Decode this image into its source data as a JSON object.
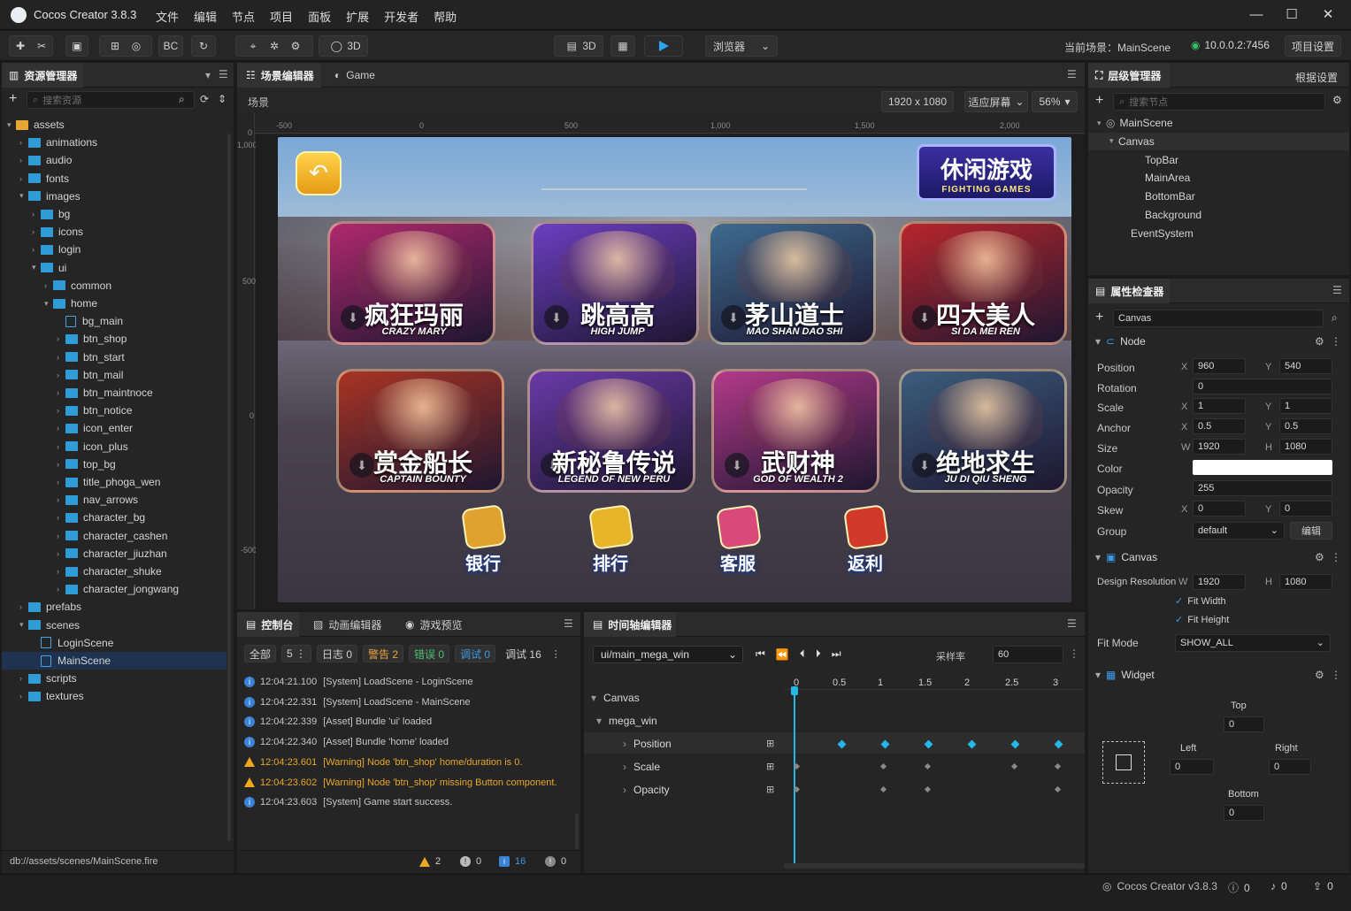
{
  "app": {
    "title": "Cocos Creator 3.8.3"
  },
  "menu": [
    "文件",
    "编辑",
    "节点",
    "项目",
    "面板",
    "扩展",
    "开发者",
    "帮助"
  ],
  "toolbar": {
    "left_btns": [
      "BC"
    ],
    "mode_3d": "3D",
    "mode_3d_b": "3D",
    "browser": "浏览器",
    "current_scene_label": "当前场景：MainScene",
    "ip": "10.0.0.2:7456",
    "project_settings": "项目设置"
  },
  "assets_panel": {
    "title": "资源管理器",
    "search_placeholder": "搜索资源",
    "tree": [
      {
        "label": "assets",
        "depth": 0,
        "open": true,
        "type": "folder"
      },
      {
        "label": "animations",
        "depth": 1,
        "type": "folder"
      },
      {
        "label": "audio",
        "depth": 1,
        "type": "folder"
      },
      {
        "label": "fonts",
        "depth": 1,
        "type": "folder"
      },
      {
        "label": "images",
        "depth": 1,
        "open": true,
        "type": "folder"
      },
      {
        "label": "bg",
        "depth": 2,
        "type": "folder"
      },
      {
        "label": "icons",
        "depth": 2,
        "type": "folder"
      },
      {
        "label": "login",
        "depth": 2,
        "type": "folder"
      },
      {
        "label": "ui",
        "depth": 2,
        "open": true,
        "type": "folder"
      },
      {
        "label": "common",
        "depth": 3,
        "type": "folder"
      },
      {
        "label": "home",
        "depth": 3,
        "open": true,
        "type": "folder"
      },
      {
        "label": "bg_main",
        "depth": 4,
        "type": "file"
      },
      {
        "label": "btn_shop",
        "depth": 4,
        "type": "folder"
      },
      {
        "label": "btn_start",
        "depth": 4,
        "type": "folder"
      },
      {
        "label": "btn_mail",
        "depth": 4,
        "type": "folder"
      },
      {
        "label": "btn_maintnoce",
        "depth": 4,
        "type": "folder"
      },
      {
        "label": "btn_notice",
        "depth": 4,
        "type": "folder"
      },
      {
        "label": "icon_enter",
        "depth": 4,
        "type": "folder"
      },
      {
        "label": "icon_plus",
        "depth": 4,
        "type": "folder"
      },
      {
        "label": "top_bg",
        "depth": 4,
        "type": "folder"
      },
      {
        "label": "title_phoga_wen",
        "depth": 4,
        "type": "folder"
      },
      {
        "label": "nav_arrows",
        "depth": 4,
        "type": "folder"
      },
      {
        "label": "character_bg",
        "depth": 4,
        "type": "folder"
      },
      {
        "label": "character_cashen",
        "depth": 4,
        "type": "folder"
      },
      {
        "label": "character_jiuzhan",
        "depth": 4,
        "type": "folder"
      },
      {
        "label": "character_shuke",
        "depth": 4,
        "type": "folder"
      },
      {
        "label": "character_jongwang",
        "depth": 4,
        "type": "folder"
      },
      {
        "label": "prefabs",
        "depth": 1,
        "type": "folder"
      },
      {
        "label": "scenes",
        "depth": 1,
        "open": true,
        "type": "folder"
      },
      {
        "label": "LoginScene",
        "depth": 2,
        "type": "file"
      },
      {
        "label": "MainScene",
        "depth": 2,
        "type": "file",
        "selected": true
      },
      {
        "label": "scripts",
        "depth": 1,
        "type": "folder"
      },
      {
        "label": "textures",
        "depth": 1,
        "type": "folder"
      }
    ],
    "path": "db://assets/scenes/MainScene.fire"
  },
  "scene_editor": {
    "tabs": [
      "场景编辑器",
      "Game"
    ],
    "breadcrumb": "场景",
    "resolution": "1920 x 1080",
    "fit": "适应屏幕",
    "zoom": "56%",
    "ruler_x": [
      "-500",
      "0",
      "500",
      "1,000",
      "1,500",
      "2,000"
    ],
    "ruler_y": [
      "1,000",
      "500",
      "0",
      "-500"
    ],
    "ruler_y_top": "0"
  },
  "game": {
    "badge_cn": "休闲游戏",
    "badge_en": "FIGHTING GAMES",
    "cards": [
      {
        "cn": "疯狂玛丽",
        "en": "CRAZY MARY",
        "color": "#b0296f"
      },
      {
        "cn": "跳高高",
        "en": "HIGH JUMP",
        "color": "#6b3fc0"
      },
      {
        "cn": "茅山道士",
        "en": "MAO SHAN DAO SHI",
        "color": "#3e6b8f"
      },
      {
        "cn": "四大美人",
        "en": "SI DA MEI REN",
        "color": "#b8262d"
      },
      {
        "cn": "赏金船长",
        "en": "CAPTAIN BOUNTY",
        "color": "#a93424"
      },
      {
        "cn": "新秘鲁传说",
        "en": "LEGEND OF NEW PERU",
        "color": "#6a3aa8"
      },
      {
        "cn": "武财神",
        "en": "GOD OF WEALTH 2",
        "color": "#b43a8a"
      },
      {
        "cn": "绝地求生",
        "en": "JU DI QIU SHENG",
        "color": "#3c5d7d"
      }
    ],
    "bottom_buttons": [
      "银行",
      "排行",
      "客服",
      "返利"
    ]
  },
  "console": {
    "tabs": [
      "控制台",
      "动画编辑器",
      "游戏预览"
    ],
    "filters": {
      "all": "全部",
      "count": "5",
      "log": "日志 0",
      "warn": "警告 2",
      "err": "错误 0",
      "debug_tab": "调试 0",
      "debug": "调试 16"
    },
    "logs": [
      {
        "type": "info",
        "time": "12:04:21.100",
        "msg": "[System] LoadScene - LoginScene"
      },
      {
        "type": "info",
        "time": "12:04:22.331",
        "msg": "[System] LoadScene - MainScene"
      },
      {
        "type": "info",
        "time": "12:04:22.339",
        "msg": "[Asset] Bundle 'ui' loaded"
      },
      {
        "type": "info",
        "time": "12:04:22.340",
        "msg": "[Asset] Bundle 'home' loaded"
      },
      {
        "type": "warn",
        "time": "12:04:23.601",
        "msg": "[Warning] Node 'btn_shop' home/duration is 0."
      },
      {
        "type": "warn",
        "time": "12:04:23.602",
        "msg": "[Warning] Node 'btn_shop' missing Button component."
      },
      {
        "type": "info",
        "time": "12:04:23.603",
        "msg": "[System] Game start success."
      }
    ],
    "status": {
      "warn": "2",
      "err": "0",
      "info": "16",
      "other": "0"
    }
  },
  "timeline": {
    "title": "时间轴编辑器",
    "clip": "ui/main_mega_win",
    "sample_label": "采样率",
    "sample": "60",
    "ticks": [
      "0",
      "0.5",
      "1",
      "1.5",
      "2",
      "2.5",
      "3"
    ],
    "tracks": [
      "Canvas",
      "mega_win",
      "Position",
      "Scale",
      "Opacity"
    ]
  },
  "hierarchy": {
    "title": "层级管理器",
    "extra": "根据设置",
    "search_placeholder": "搜索节点",
    "nodes": [
      {
        "label": "MainScene",
        "depth": 0
      },
      {
        "label": "Canvas",
        "depth": 1
      },
      {
        "label": "TopBar",
        "depth": 2
      },
      {
        "label": "MainArea",
        "depth": 2
      },
      {
        "label": "BottomBar",
        "depth": 2
      },
      {
        "label": "Background",
        "depth": 2
      },
      {
        "label": "EventSystem",
        "depth": 1
      }
    ]
  },
  "inspector": {
    "title": "属性检查器",
    "node_name": "Canvas",
    "node_section": "Node",
    "position": {
      "label": "Position",
      "x": "960",
      "y": "540"
    },
    "rotation": {
      "label": "Rotation",
      "v": "0"
    },
    "scale": {
      "label": "Scale",
      "x": "1",
      "y": "1"
    },
    "anchor": {
      "label": "Anchor",
      "x": "0.5",
      "y": "0.5"
    },
    "size": {
      "label": "Size",
      "w": "1920",
      "h": "1080"
    },
    "color": {
      "label": "Color",
      "value": "#ffffff"
    },
    "opacity": {
      "label": "Opacity",
      "v": "255"
    },
    "skew": {
      "label": "Skew",
      "x": "0",
      "y": "0"
    },
    "group": {
      "label": "Group",
      "v": "default",
      "btn": "编辑"
    },
    "canvas_section": "Canvas",
    "design_res": {
      "label": "Design Resolution",
      "w": "1920",
      "h": "1080"
    },
    "fit_width": "Fit Width",
    "fit_height": "Fit Height",
    "fit_mode": {
      "label": "Fit Mode",
      "v": "SHOW_ALL"
    },
    "widget_section": "Widget",
    "widget": {
      "top_label": "Top",
      "top": "0",
      "left_label": "Left",
      "left": "0",
      "right_label": "Right",
      "right": "0",
      "bottom_label": "Bottom",
      "bottom": "0"
    }
  },
  "statusbar": {
    "version": "Cocos Creator v3.8.3",
    "a": "0",
    "b": "0",
    "c": "0"
  }
}
